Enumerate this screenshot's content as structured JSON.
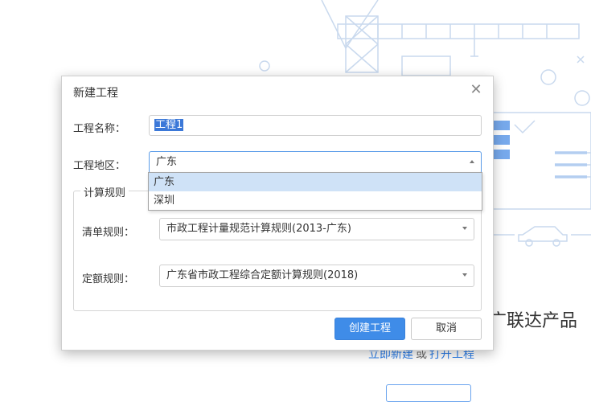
{
  "background": {
    "product_text": "广联达产品",
    "link_new": "立即新建",
    "link_or": "或",
    "link_open": "打开工程"
  },
  "dialog": {
    "title": "新建工程",
    "close_glyph": "✕",
    "project_name": {
      "label": "工程名称：",
      "value": "工程1"
    },
    "region": {
      "label": "工程地区：",
      "selected": "广东",
      "options": [
        "广东",
        "深圳"
      ]
    },
    "rules_group": {
      "legend": "计算规则",
      "list_rule": {
        "label": "清单规则：",
        "value": "市政工程计量规范计算规则(2013-广东)"
      },
      "quota_rule": {
        "label": "定额规则：",
        "value": "广东省市政工程综合定额计算规则(2018)"
      }
    },
    "create_button": "创建工程",
    "cancel_button": "取消"
  },
  "colors": {
    "accent": "#3f8ce8",
    "dropdown_highlight": "#cfe2f7",
    "illustration_line": "#c9d9ee"
  }
}
